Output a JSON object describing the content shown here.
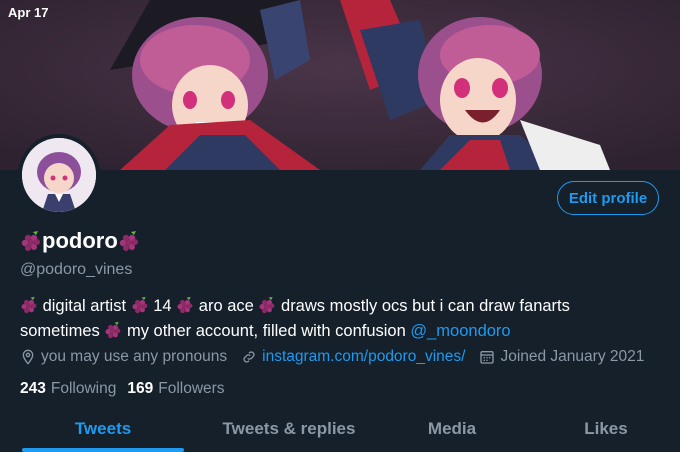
{
  "status_bar": {
    "time": "Apr 17"
  },
  "profile": {
    "display_name": "podoro",
    "handle": "@podoro_vines",
    "edit_button": "Edit profile",
    "bio": {
      "part1": "digital artist",
      "part2": "14",
      "part3": "aro ace",
      "part4": "draws mostly ocs but i can draw fanarts",
      "part5": "sometimes",
      "part6": "my other account, filled with confusion",
      "mention": "@_moondoro"
    },
    "location": "you may use any pronouns",
    "website": "instagram.com/podoro_vines/",
    "joined": "Joined January 2021",
    "following_count": "243",
    "following_label": "Following",
    "followers_count": "169",
    "followers_label": "Followers"
  },
  "tabs": [
    {
      "label": "Tweets",
      "active": true
    },
    {
      "label": "Tweets & replies",
      "active": false
    },
    {
      "label": "Media",
      "active": false
    },
    {
      "label": "Likes",
      "active": false
    }
  ],
  "colors": {
    "background": "#15202b",
    "accent": "#1d9bf0",
    "muted": "#8b98a5"
  },
  "icons": [
    "location-pin-icon",
    "link-icon",
    "calendar-icon",
    "grape-emoji-icon"
  ]
}
